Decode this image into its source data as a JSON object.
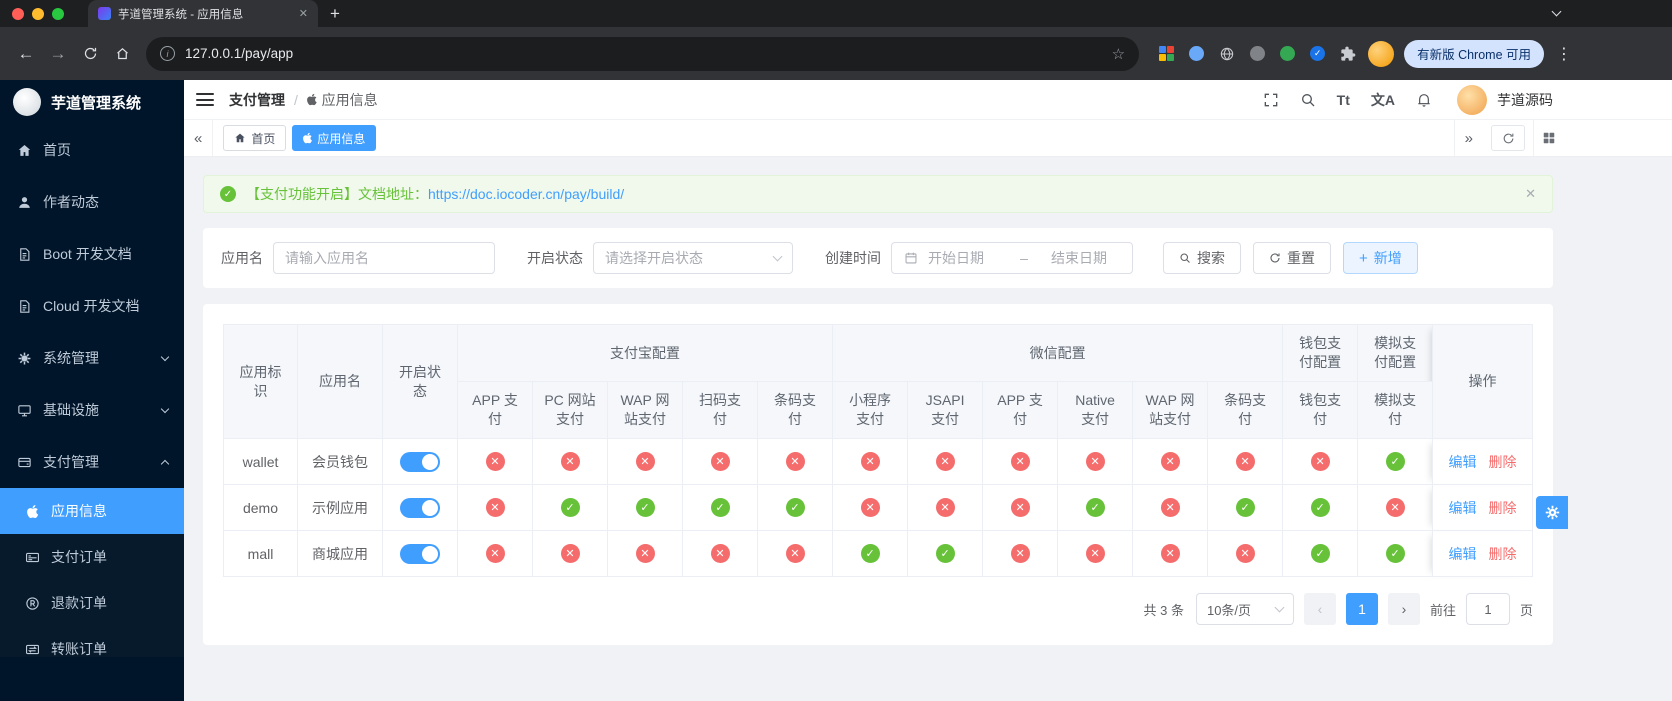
{
  "colors": {
    "primary": "#409eff",
    "success": "#67c23a",
    "danger": "#f56c6c",
    "sidebar_bg": "#001529"
  },
  "glyphs": {
    "check": "✓",
    "cross": "✕",
    "close": "✕",
    "plus": "+",
    "back_arrow": "←",
    "forward_arrow": "→",
    "overflow_menu": "⋮",
    "page_prev": "‹",
    "page_next": "›",
    "tags_prev": "«",
    "tags_next": "»",
    "bookmark_star": "☆"
  },
  "browser": {
    "tab_title": "芋道管理系统 - 应用信息",
    "url": "127.0.0.1/pay/app",
    "update_chip_label": "有新版 Chrome 可用"
  },
  "sidebar": {
    "logo_title": "芋道管理系统",
    "menu": [
      {
        "label": "首页",
        "icon": "home-icon",
        "arrow": null
      },
      {
        "label": "作者动态",
        "icon": "user-icon",
        "arrow": null
      },
      {
        "label": "Boot 开发文档",
        "icon": "doc-icon",
        "arrow": null
      },
      {
        "label": "Cloud 开发文档",
        "icon": "doc-icon",
        "arrow": null
      },
      {
        "label": "系统管理",
        "icon": "gear-icon",
        "arrow": "down"
      },
      {
        "label": "基础设施",
        "icon": "monitor-icon",
        "arrow": "down"
      },
      {
        "label": "支付管理",
        "icon": "pay-icon",
        "arrow": "up"
      }
    ],
    "submenu": [
      {
        "label": "应用信息",
        "icon": "apple-icon",
        "active": true
      },
      {
        "label": "支付订单",
        "icon": "card-icon",
        "active": false
      },
      {
        "label": "退款订单",
        "icon": "refund-icon",
        "active": false
      },
      {
        "label": "转账订单",
        "icon": "transfer-icon",
        "active": false
      }
    ]
  },
  "header": {
    "breadcrumb": [
      "支付管理",
      "应用信息"
    ],
    "user_name": "芋道源码"
  },
  "tagbar": {
    "tags": [
      {
        "label": "首页",
        "icon": "home-icon",
        "active": false
      },
      {
        "label": "应用信息",
        "icon": "apple-icon",
        "active": true
      }
    ]
  },
  "alert": {
    "message": "【支付功能开启】文档地址：",
    "link": "https://doc.iocoder.cn/pay/build/"
  },
  "filter": {
    "name_label": "应用名",
    "name_placeholder": "请输入应用名",
    "status_label": "开启状态",
    "status_placeholder": "请选择开启状态",
    "time_label": "创建时间",
    "start_placeholder": "开始日期",
    "range_separator": "–",
    "end_placeholder": "结束日期",
    "search_label": "搜索",
    "reset_label": "重置",
    "add_label": "新增"
  },
  "table": {
    "col_app_id": "应用标识",
    "col_app_name": "应用名",
    "col_status": "开启状态",
    "col_action": "操作",
    "group_alipay": "支付宝配置",
    "group_wechat": "微信配置",
    "group_wallet": "钱包支付配置",
    "group_mock": "模拟支付配置",
    "alipay_columns": [
      "APP 支付",
      "PC 网站支付",
      "WAP 网站支付",
      "扫码支付",
      "条码支付"
    ],
    "wechat_columns": [
      "小程序支付",
      "JSAPI 支付",
      "APP 支付",
      "Native 支付",
      "WAP 网站支付",
      "条码支付"
    ],
    "wallet_columns": [
      "钱包支付"
    ],
    "mock_columns": [
      "模拟支付"
    ],
    "edit_label": "编辑",
    "delete_label": "删除",
    "rows": [
      {
        "app_id": "wallet",
        "app_name": "会员钱包",
        "enabled": true,
        "channels": [
          false,
          false,
          false,
          false,
          false,
          false,
          false,
          false,
          false,
          false,
          false,
          false,
          true
        ]
      },
      {
        "app_id": "demo",
        "app_name": "示例应用",
        "enabled": true,
        "channels": [
          false,
          true,
          true,
          true,
          true,
          false,
          false,
          false,
          true,
          false,
          true,
          true,
          false
        ]
      },
      {
        "app_id": "mall",
        "app_name": "商城应用",
        "enabled": true,
        "channels": [
          false,
          false,
          false,
          false,
          false,
          true,
          true,
          false,
          false,
          false,
          false,
          true,
          true
        ]
      }
    ]
  },
  "pagination": {
    "total_text": "共 3 条",
    "page_size_text": "10条/页",
    "current_page": "1",
    "goto_label": "前往",
    "goto_value": "1",
    "unit_label": "页"
  }
}
